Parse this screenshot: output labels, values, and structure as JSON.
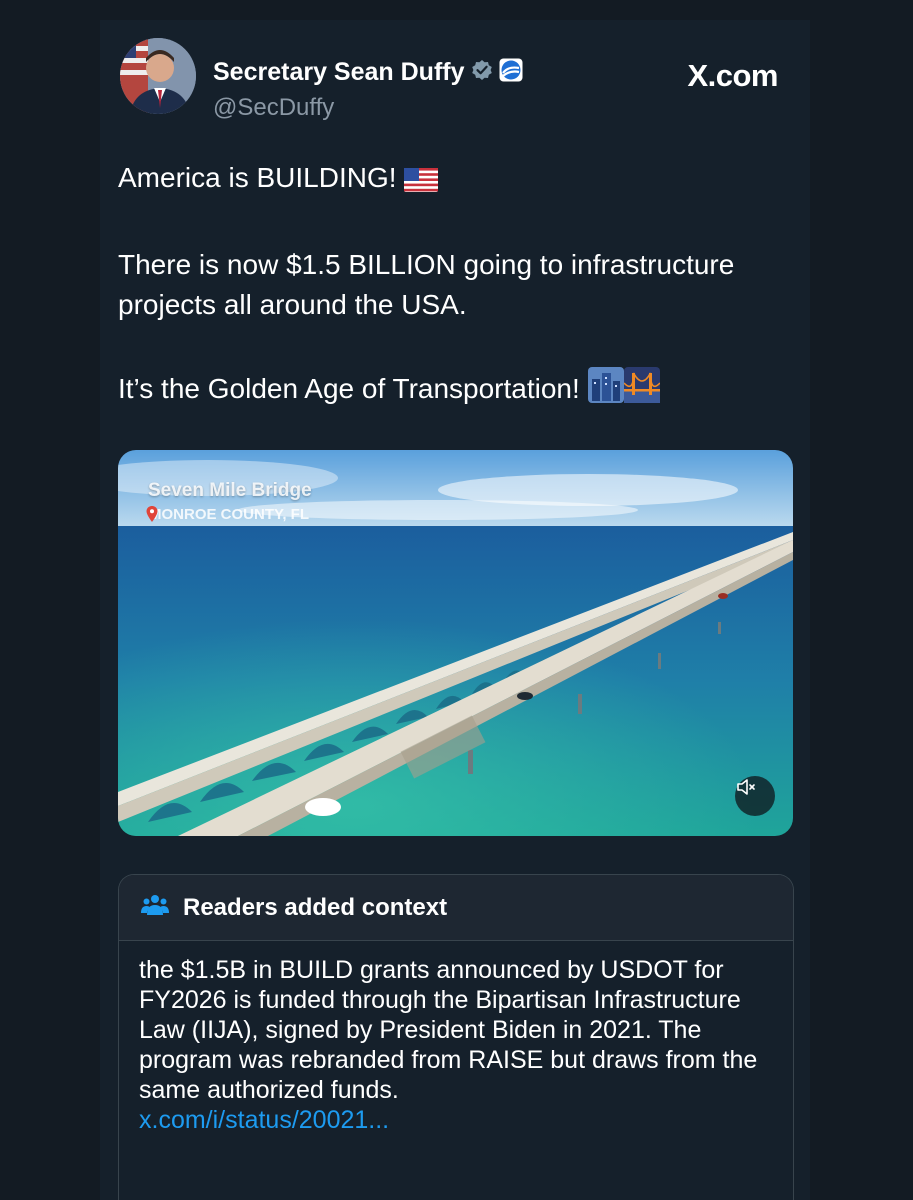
{
  "brand": {
    "site": "X.com"
  },
  "author": {
    "name": "Secretary Sean Duffy",
    "handle": "@SecDuffy",
    "badges": [
      "verified-badge-icon",
      "dot-logo-icon"
    ]
  },
  "tweet": {
    "lines": [
      "America is BUILDING!",
      "There is now $1.5 BILLION going to infrastructure projects all around the USA.",
      "It’s the Golden Age of Transportation!"
    ],
    "emojis": [
      "us-flag-icon",
      "cityscape-icon",
      "bridge-at-night-icon"
    ]
  },
  "media": {
    "title": "Seven Mile Bridge",
    "location": "MONROE COUNTY, FL",
    "mute_icon": "speaker-muted-icon"
  },
  "context": {
    "title": "Readers added context",
    "body": "the $1.5B in BUILD grants announced by USDOT for FY2026 is funded through the Bipartisan Infrastructure Law (IIJA), signed by President Biden in 2021. The program was rebranded from RAISE but draws from the same authorized funds.",
    "link": "x.com/i/status/20021..."
  },
  "colors": {
    "background": "#131b23",
    "card": "#15202b",
    "link": "#1d9bf0",
    "verified": "#829aab",
    "dot_logo": "#1f6fd4"
  }
}
